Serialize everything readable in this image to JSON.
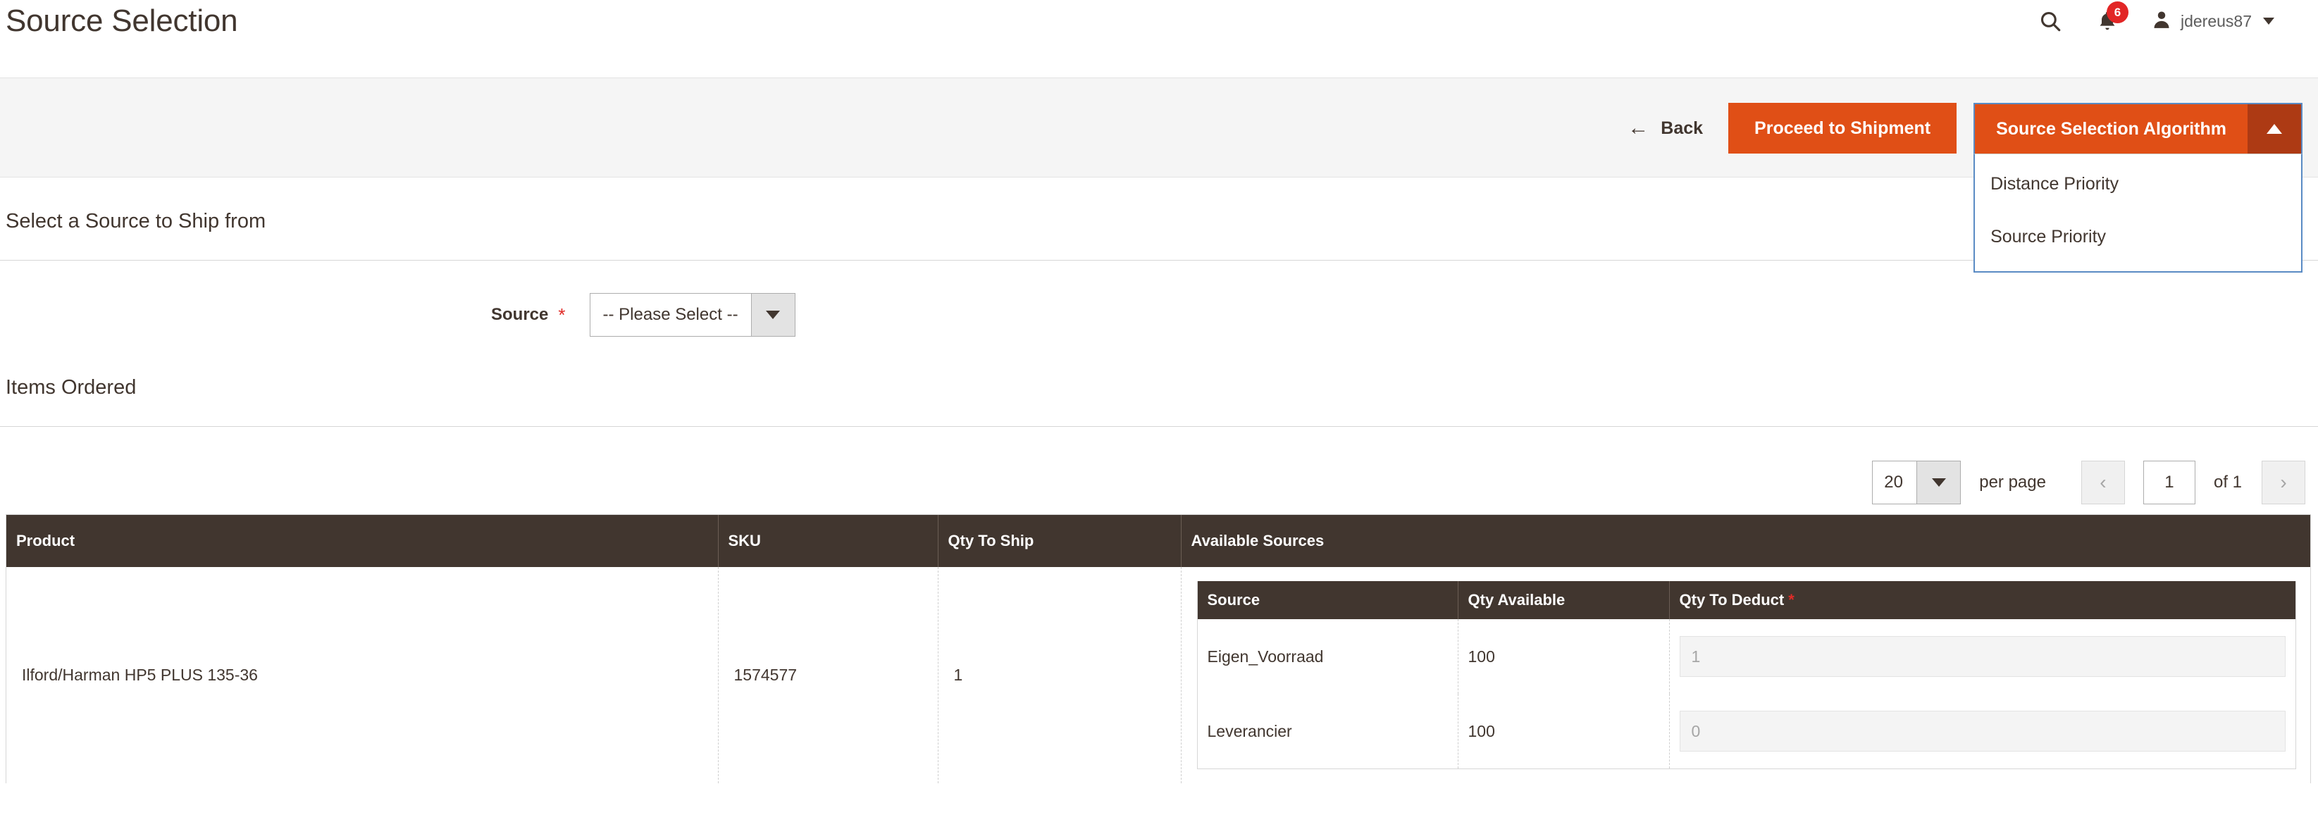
{
  "header": {
    "title": "Source Selection",
    "search_icon": "search-icon",
    "notifications_icon": "bell-icon",
    "notifications_count": "6",
    "user_icon": "user-avatar-icon",
    "user_name": "jdereus87",
    "user_caret": "chevron-down-icon"
  },
  "actions": {
    "back_label": "Back",
    "back_arrow": "←",
    "primary_label": "Proceed to Shipment",
    "split_label": "Source Selection Algorithm",
    "split_toggle_icon": "chevron-up-icon",
    "menu_items": [
      {
        "label": "Distance Priority"
      },
      {
        "label": "Source Priority"
      }
    ],
    "accent_color": "#e04f16",
    "accent_dark_color": "#ad3a14",
    "menu_border_color": "#5a8bc4"
  },
  "source_section": {
    "title": "Select a Source to Ship from",
    "field_label": "Source",
    "required_marker": "*",
    "select_value": "-- Please Select --",
    "select_arrow_icon": "chevron-down-icon"
  },
  "items_section": {
    "title": "Items Ordered"
  },
  "pager": {
    "per_page_value": "20",
    "per_page_arrow_icon": "chevron-down-icon",
    "per_page_label": "per page",
    "prev_icon": "‹",
    "page_value": "1",
    "of_label": "of 1",
    "next_icon": "›"
  },
  "grid": {
    "columns": [
      "Product",
      "SKU",
      "Qty To Ship",
      "Available Sources"
    ],
    "rows": [
      {
        "product": "Ilford/Harman HP5 PLUS 135-36",
        "sku": "1574577",
        "qty_to_ship": "1",
        "sources": {
          "columns": [
            "Source",
            "Qty Available",
            "Qty To Deduct"
          ],
          "required_marker": "*",
          "rows": [
            {
              "source": "Eigen_Voorraad",
              "qty_available": "100",
              "qty_to_deduct": "1"
            },
            {
              "source": "Leverancier",
              "qty_available": "100",
              "qty_to_deduct": "0"
            }
          ]
        }
      }
    ]
  }
}
